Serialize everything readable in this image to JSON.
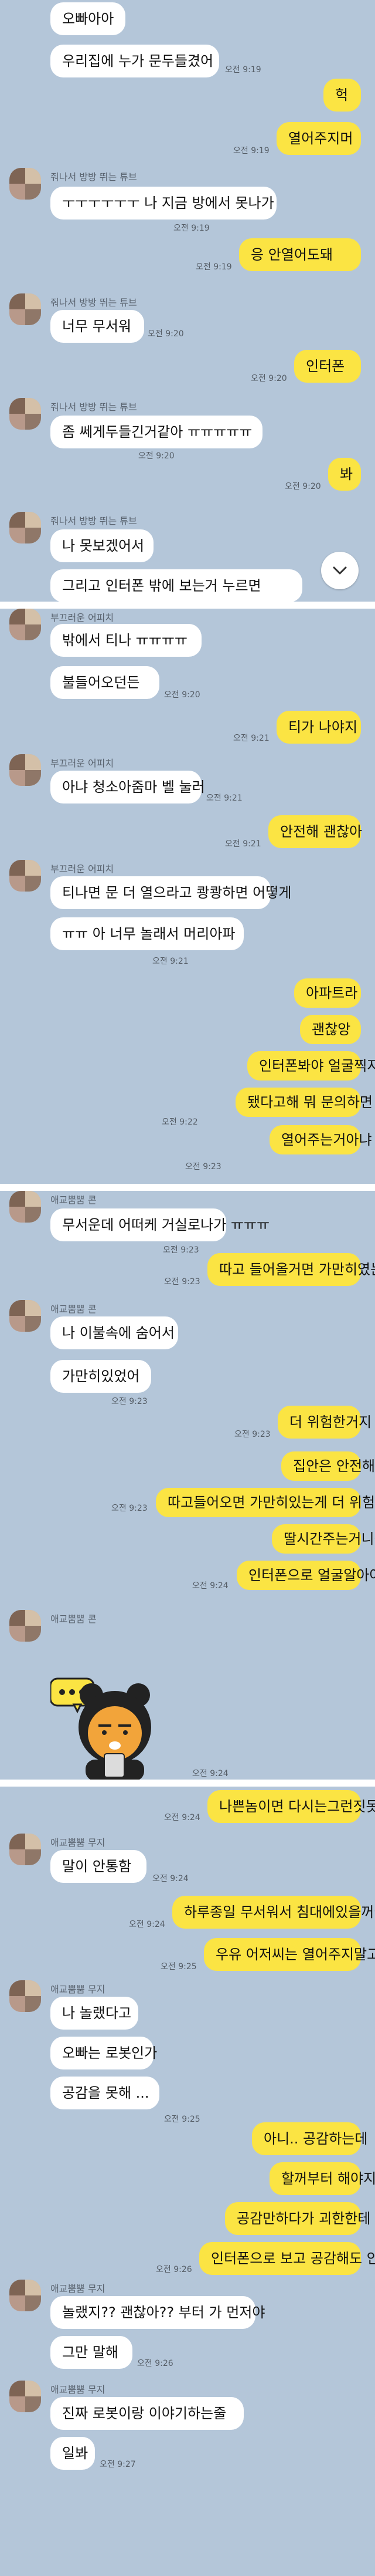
{
  "panels": [
    {
      "rows": [
        {
          "side": "in",
          "text": "오빠아아"
        },
        {
          "side": "in",
          "text": "우리집에 누가 문두들겼어",
          "time": "오전 9:19"
        },
        {
          "side": "out",
          "text": "헉"
        },
        {
          "side": "out",
          "text": "열어주지머",
          "time": "오전 9:19"
        },
        {
          "side": "in",
          "name": "줘나서 방방 뛰는 튜브",
          "text": "ㅜㅜㅜㅜㅜㅜ 나 지금 방에서 못나가",
          "time": "오전 9:19"
        },
        {
          "side": "out",
          "text": "응 안열어도돼",
          "time": "오전 9:19"
        },
        {
          "side": "in",
          "name": "줘나서 방방 뛰는 튜브",
          "text": "너무 무서워",
          "time": "오전 9:20"
        },
        {
          "side": "out",
          "text": "인터폰",
          "time": "오전 9:20"
        },
        {
          "side": "in",
          "name": "줘나서 방방 뛰는 튜브",
          "text": "좀 쎄게두들긴거같아 ㅠㅠㅠㅠㅠ",
          "time": "오전 9:20"
        },
        {
          "side": "out",
          "text": "봐",
          "time": "오전 9:20"
        },
        {
          "side": "in",
          "name": "줘나서 방방 뛰는 튜브",
          "text": "나 못보겠어서"
        },
        {
          "side": "in",
          "text": "그리고 인터폰 밖에 보는거 누르면"
        }
      ]
    },
    {
      "rows": [
        {
          "side": "in",
          "name": "부끄러운 어피치",
          "text": "밖에서 티나 ㅠㅠㅠㅠ"
        },
        {
          "side": "in",
          "text": "불들어오던든",
          "time": "오전 9:20"
        },
        {
          "side": "out",
          "text": "티가 나야지",
          "time": "오전 9:21"
        },
        {
          "side": "in",
          "name": "부끄러운 어피치",
          "text": "아냐 청소아줌마 벨 눌러",
          "time": "오전 9:21"
        },
        {
          "side": "out",
          "text": "안전해 괜찮아",
          "time": "오전 9:21"
        },
        {
          "side": "in",
          "name": "부끄러운 어피치",
          "text": "티나면 문 더 열으라고 쾅쾅하면 어떻게"
        },
        {
          "side": "in",
          "text": "ㅠㅠ 아 너무 놀래서 머리아파",
          "time": "오전 9:21"
        },
        {
          "side": "out",
          "text": "아파트라"
        },
        {
          "side": "out",
          "text": "괜찮앙"
        },
        {
          "side": "out",
          "text": "인터폰봐야 얼굴찍지"
        },
        {
          "side": "out",
          "text": "됐다고해 뭐 문의하면",
          "time": "오전 9:22"
        },
        {
          "side": "out",
          "text": "열어주는거아냐",
          "time": "오전 9:23"
        }
      ]
    },
    {
      "rows": [
        {
          "side": "in",
          "name": "애교뿜뿜 콘",
          "text": "무서운데 어떠케 거실로나가 ㅠㅠㅠ",
          "time": "오전 9:23"
        },
        {
          "side": "out",
          "text": "따고 들어올거면 가만히였는게",
          "time": "오전 9:23"
        },
        {
          "side": "in",
          "name": "애교뿜뿜 콘",
          "text": "나 이불속에 숨어서"
        },
        {
          "side": "in",
          "text": "가만히있었어",
          "time": "오전 9:23"
        },
        {
          "side": "out",
          "text": "더 위험한거지",
          "time": "오전 9:23"
        },
        {
          "side": "out",
          "text": "집안은 안전해"
        },
        {
          "side": "out",
          "text": "따고들어오면 가만히있는게 더 위험하지",
          "time": "오전 9:23"
        },
        {
          "side": "out",
          "text": "딸시간주는거니깐"
        },
        {
          "side": "out",
          "text": "인터폰으로 얼굴알아야지",
          "time": "오전 9:24"
        },
        {
          "side": "in",
          "name": "애교뿜뿜 콘",
          "emoticon": "ryan-emoticon",
          "time": "오전 9:24"
        }
      ]
    },
    {
      "rows": [
        {
          "side": "out",
          "text": "나쁜놈이면 다시는그런짓못해",
          "time": "오전 9:24"
        },
        {
          "side": "in",
          "name": "애교뿜뿜 무지",
          "text": "말이 안통함",
          "time": "오전 9:24"
        },
        {
          "side": "out",
          "text": "하루종일 무서워서 침대에있을꺼야?",
          "time": "오전 9:24"
        },
        {
          "side": "out",
          "text": "우유 어저씨는 열어주지말고",
          "time": "오전 9:25"
        },
        {
          "side": "in",
          "name": "애교뿜뿜 무지",
          "text": "나 놀랬다고"
        },
        {
          "side": "in",
          "text": "오빠는 로봇인가"
        },
        {
          "side": "in",
          "text": "공감을 못해 ...",
          "time": "오전 9:25"
        },
        {
          "side": "out",
          "text": "아니.. 공감하는데"
        },
        {
          "side": "out",
          "text": "할꺼부터 해야지"
        },
        {
          "side": "out",
          "text": "공감만하다가 괴한한테 당한다"
        },
        {
          "side": "out",
          "text": "인터폰으로 보고 공감해도 안늦어",
          "time": "오전 9:26"
        },
        {
          "side": "in",
          "name": "애교뿜뿜 무지",
          "text": "놀랬지?? 괜찮아?? 부터 가 먼저야"
        },
        {
          "side": "in",
          "text": "그만 말해",
          "time": "오전 9:26"
        },
        {
          "side": "in",
          "name": "애교뿜뿜 무지",
          "text": "진짜 로봇이랑 이야기하는줄"
        },
        {
          "side": "in",
          "text": "일봐",
          "time": "오전 9:27"
        }
      ]
    }
  ],
  "scroll_down_icon": "chevron-down-icon",
  "colors": {
    "background": "#b4c6d9",
    "incoming_bubble": "#ffffff",
    "outgoing_bubble": "#fbe443"
  }
}
